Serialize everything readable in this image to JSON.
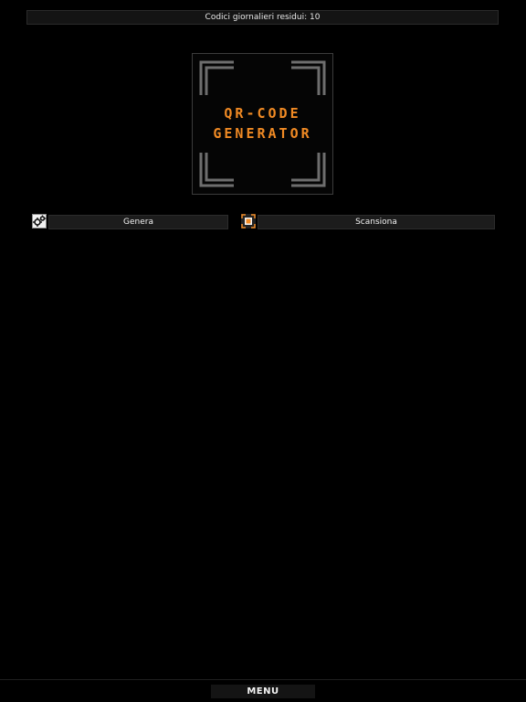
{
  "status": {
    "codes_remaining_text": "Codici giornalieri residui: 10"
  },
  "logo": {
    "line1": "QR-CODE",
    "line2": "GENERATOR"
  },
  "actions": {
    "generate_label": "Genera",
    "scan_label": "Scansiona"
  },
  "footer": {
    "menu_label": "MENU"
  },
  "colors": {
    "background": "#000000",
    "accent": "#f08a24",
    "panel": "#1c1c1c"
  },
  "icons": {
    "generate": "gears-icon",
    "scan": "qr-scan-icon"
  }
}
